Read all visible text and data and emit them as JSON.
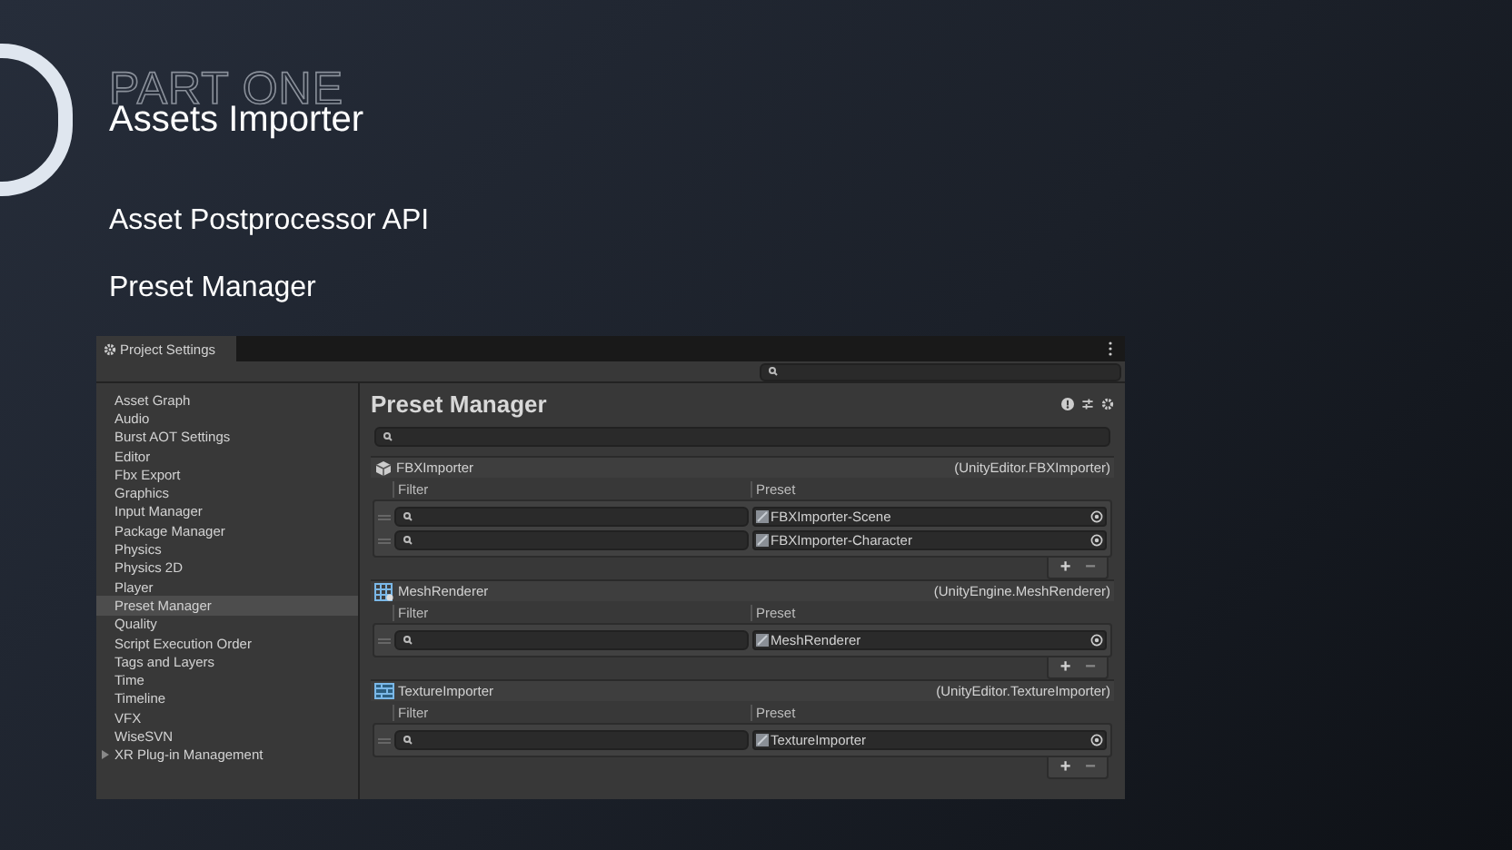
{
  "slide": {
    "overline": "PART ONE",
    "title": "Assets Importer",
    "bullets": [
      "Asset Postprocessor API",
      "Preset Manager"
    ]
  },
  "window": {
    "tab": "Project Settings"
  },
  "sidebar": {
    "items": [
      {
        "label": "Asset Graph",
        "selected": false,
        "kind": "page"
      },
      {
        "label": "Audio",
        "selected": false,
        "kind": "page"
      },
      {
        "label": "Burst AOT Settings",
        "selected": false,
        "kind": "page"
      },
      {
        "label": "Editor",
        "selected": false,
        "kind": "page"
      },
      {
        "label": "Fbx Export",
        "selected": false,
        "kind": "page"
      },
      {
        "label": "Graphics",
        "selected": false,
        "kind": "page"
      },
      {
        "label": "Input Manager",
        "selected": false,
        "kind": "page"
      },
      {
        "label": "Package Manager",
        "selected": false,
        "kind": "page"
      },
      {
        "label": "Physics",
        "selected": false,
        "kind": "page"
      },
      {
        "label": "Physics 2D",
        "selected": false,
        "kind": "page"
      },
      {
        "label": "Player",
        "selected": false,
        "kind": "page"
      },
      {
        "label": "Preset Manager",
        "selected": true,
        "kind": "page"
      },
      {
        "label": "Quality",
        "selected": false,
        "kind": "page"
      },
      {
        "label": "Script Execution Order",
        "selected": false,
        "kind": "page"
      },
      {
        "label": "Tags and Layers",
        "selected": false,
        "kind": "page"
      },
      {
        "label": "Time",
        "selected": false,
        "kind": "page"
      },
      {
        "label": "Timeline",
        "selected": false,
        "kind": "page"
      },
      {
        "label": "VFX",
        "selected": false,
        "kind": "page"
      },
      {
        "label": "WiseSVN",
        "selected": false,
        "kind": "page"
      },
      {
        "label": "XR Plug-in Management",
        "selected": false,
        "kind": "group"
      }
    ]
  },
  "panel": {
    "title": "Preset Manager",
    "groups": [
      {
        "name": "FBXImporter",
        "type": "(UnityEditor.FBXImporter)",
        "kind": "model",
        "columns": [
          "Filter",
          "Preset"
        ],
        "rows": [
          {
            "preset": "FBXImporter-Scene"
          },
          {
            "preset": "FBXImporter-Character"
          }
        ],
        "add": "+",
        "remove": "−"
      },
      {
        "name": "MeshRenderer",
        "type": "(UnityEngine.MeshRenderer)",
        "kind": "renderer",
        "columns": [
          "Filter",
          "Preset"
        ],
        "rows": [
          {
            "preset": "MeshRenderer"
          }
        ],
        "add": "+",
        "remove": "−"
      },
      {
        "name": "TextureImporter",
        "type": "(UnityEditor.TextureImporter)",
        "kind": "texture",
        "columns": [
          "Filter",
          "Preset"
        ],
        "rows": [
          {
            "preset": "TextureImporter"
          }
        ],
        "add": "+",
        "remove": "−"
      }
    ]
  }
}
